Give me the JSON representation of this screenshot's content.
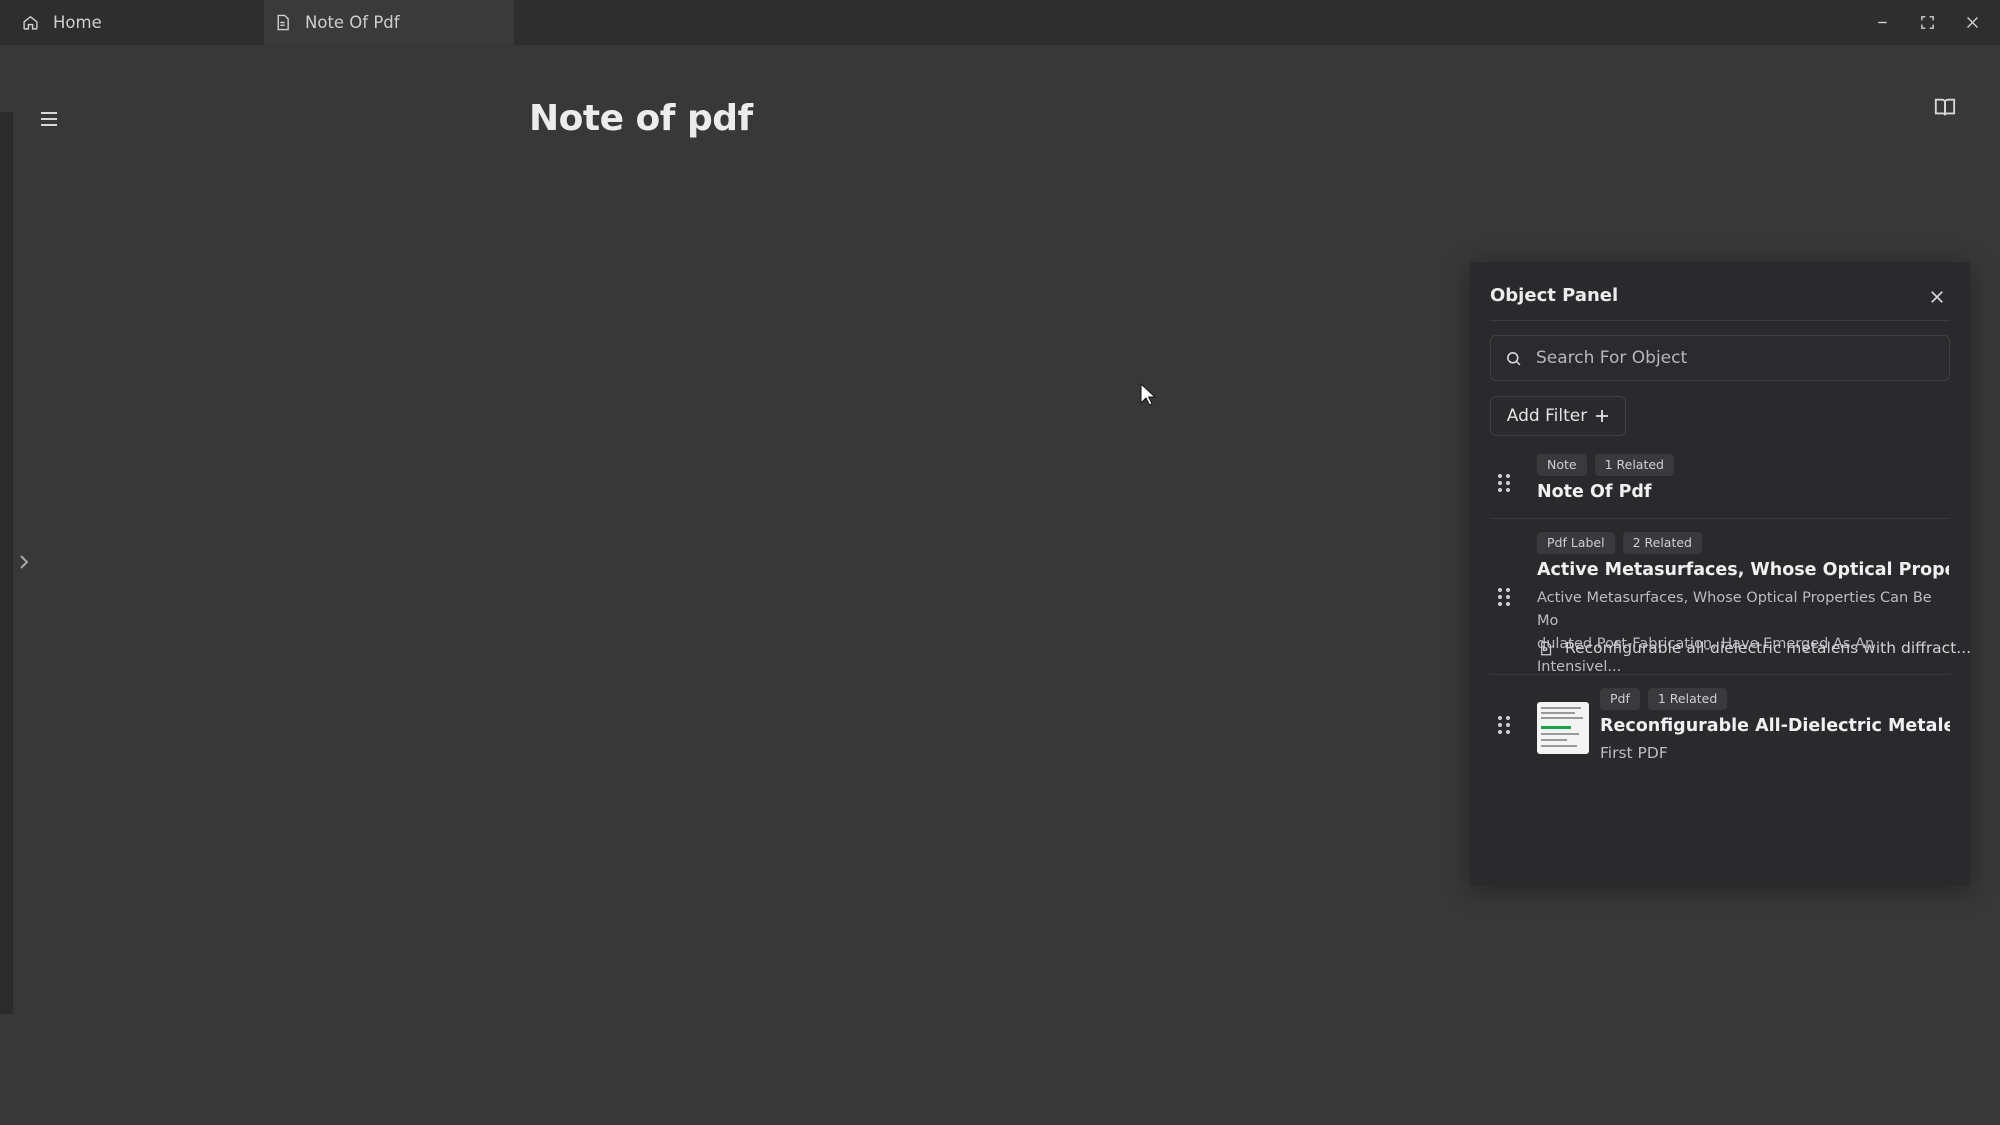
{
  "tabs": [
    {
      "label": "Home",
      "icon": "home-icon"
    },
    {
      "label": "Note Of Pdf",
      "icon": "document-icon"
    }
  ],
  "page": {
    "title": "Note of pdf"
  },
  "object_panel": {
    "title": "Object Panel",
    "search_placeholder": "Search For Object",
    "add_filter_label": "Add Filter",
    "items": [
      {
        "badges": [
          "Note",
          "1 Related"
        ],
        "title": "Note Of Pdf"
      },
      {
        "badges": [
          "Pdf Label",
          "2 Related"
        ],
        "title": "Active Metasurfaces, Whose Optical Properties C...",
        "desc_line1": "Active Metasurfaces, Whose Optical Properties Can Be Mo",
        "desc_line2": "dulated Post-Fabrication, Have Emerged As An Intensivel...",
        "ref": "Reconfigurable all-dielectric metalens with diffract..."
      },
      {
        "badges": [
          "Pdf",
          "1 Related"
        ],
        "title": "Reconfigurable All-Dielectric Metalens Wi...",
        "subtitle": "First PDF"
      }
    ]
  },
  "colors": {
    "background": "#383839",
    "panel": "#2a2a2c",
    "titlebar": "#2e2e2f"
  }
}
